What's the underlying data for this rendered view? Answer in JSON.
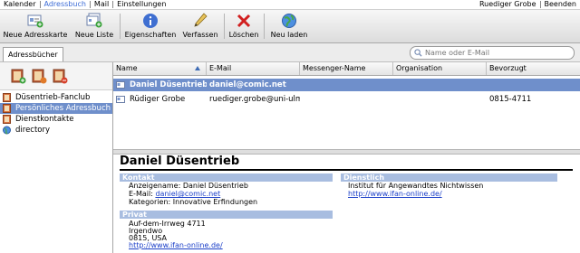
{
  "menubar": {
    "items": [
      "Kalender",
      "Adressbuch",
      "Mail",
      "Einstellungen"
    ],
    "active_item": "Adressbuch",
    "user": "Ruediger Grobe",
    "logout": "Beenden"
  },
  "toolbar": {
    "new_card": "Neue Adresskarte",
    "new_list": "Neue Liste",
    "properties": "Eigenschaften",
    "compose": "Verfassen",
    "delete": "Löschen",
    "reload": "Neu laden"
  },
  "tabs": {
    "addressbooks": "Adressbücher"
  },
  "search": {
    "placeholder": "Name oder E-Mail"
  },
  "sidebar": {
    "books": [
      {
        "label": "Düsentrieb-Fanclub"
      },
      {
        "label": "Persönliches Adressbuch"
      },
      {
        "label": "Dienstkontakte"
      },
      {
        "label": "directory"
      }
    ],
    "selected_index": 1
  },
  "list": {
    "columns": {
      "name": "Name",
      "email": "E-Mail",
      "messenger": "Messenger-Name",
      "org": "Organisation",
      "preferred": "Bevorzugt"
    },
    "rows": [
      {
        "name": "Daniel Düsentrieb",
        "email": "daniel@comic.net",
        "messenger": "",
        "org": "",
        "preferred": ""
      },
      {
        "name": "Rüdiger Grobe",
        "email": "ruediger.grobe@uni-ulm",
        "messenger": "",
        "org": "",
        "preferred": "0815-4711"
      }
    ]
  },
  "detail": {
    "name": "Daniel Düsentrieb",
    "contact": {
      "header": "Kontakt",
      "display_name": "Anzeigename: Daniel Düsentrieb",
      "email_label": "E-Mail:",
      "email": "daniel@comic.net",
      "categories": "Kategorien: Innovative Erfindungen"
    },
    "private": {
      "header": "Privat",
      "street": "Auf-dem-Irrweg 4711",
      "city": "Irgendwo",
      "zip_country": "0815, USA",
      "url": "http://www.ifan-online.de/"
    },
    "work": {
      "header": "Dienstlich",
      "org": "Institut für Angewandtes Nichtwissen",
      "url": "http://www.ifan-online.de/"
    }
  },
  "colors": {
    "selection": "#6f8fcb",
    "section_header": "#a8bde0",
    "link": "#1b3fc8",
    "active_menu": "#3b6bd6"
  }
}
